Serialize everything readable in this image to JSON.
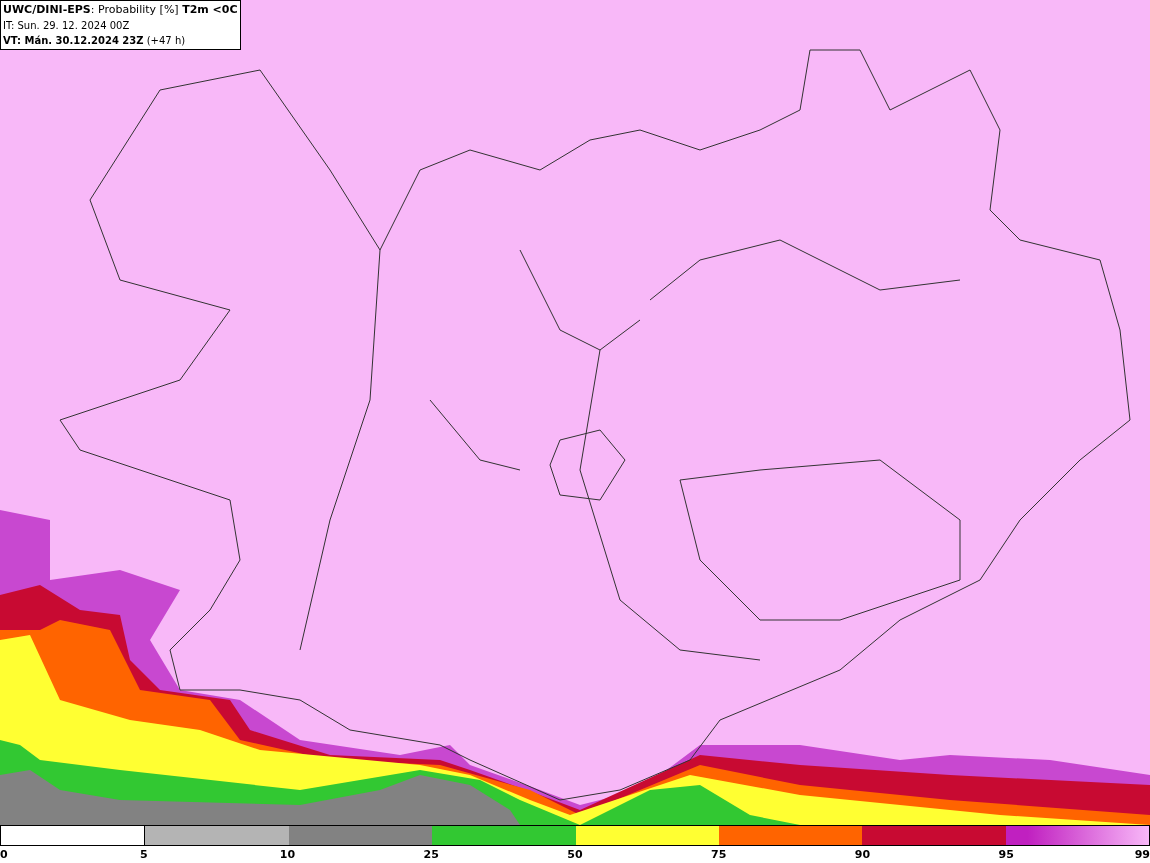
{
  "header": {
    "lines": [
      "**UWC/DINI-EPS**: Probability [%] **T2m <0C**",
      "IT: Sun. 29. 12. 2024 00Z",
      "**VT: Mán. 30.12.2024 23Z** (+47 h)"
    ]
  },
  "legend": {
    "segments": [
      {
        "color": "#ffffff"
      },
      {
        "color": "#b4b4b4"
      },
      {
        "color": "#828282"
      },
      {
        "color": "#32c832"
      },
      {
        "color": "#ffff32"
      },
      {
        "color": "#ff6400"
      },
      {
        "color": "#c80a32"
      },
      {
        "color": "#c020c0"
      }
    ],
    "ticks": [
      "0",
      "5",
      "10",
      "25",
      "50",
      "75",
      "90",
      "95",
      "99"
    ]
  }
}
